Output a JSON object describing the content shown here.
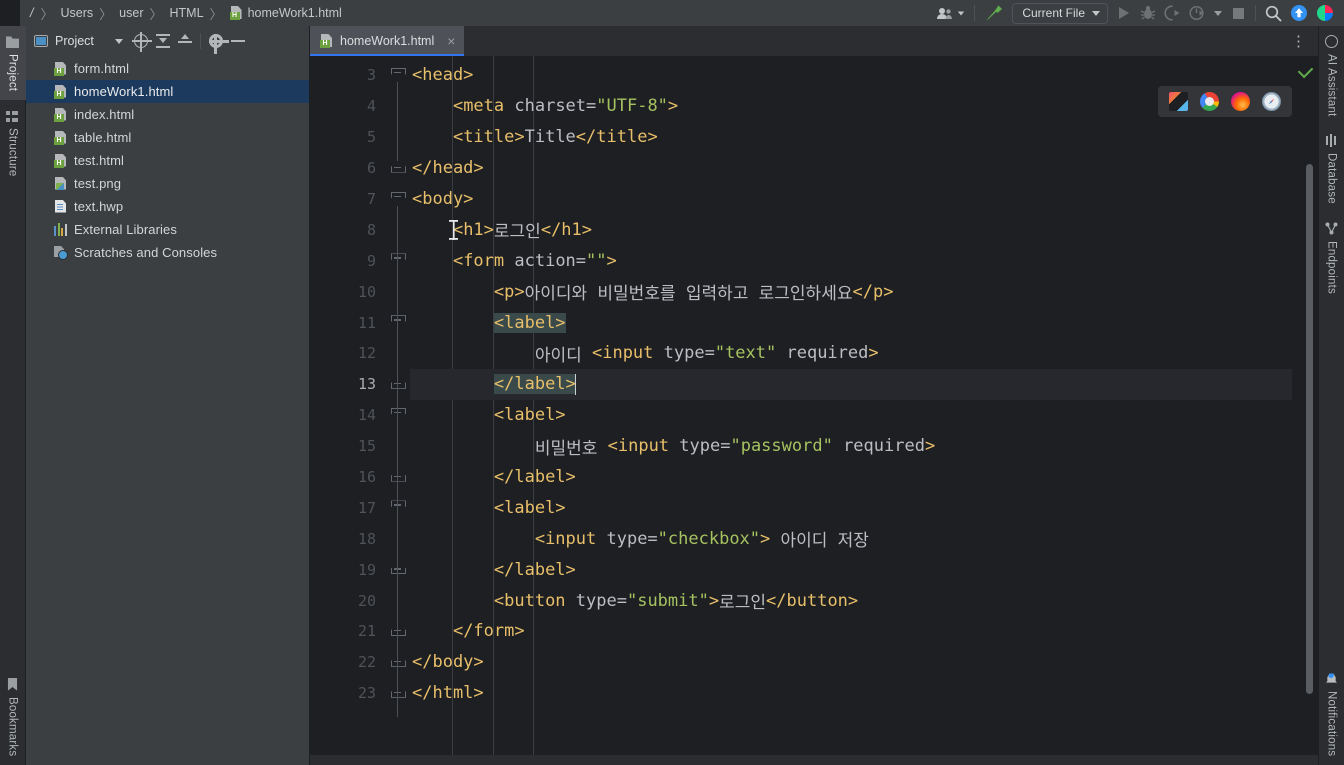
{
  "breadcrumb": {
    "root": "/",
    "items": [
      "Users",
      "user",
      "HTML"
    ],
    "file": "homeWork1.html",
    "separator": "〉"
  },
  "topbar_right": {
    "account_icon": "user-group-icon",
    "build_icon": "hammer-icon",
    "run_config": "Current File",
    "run_icon": "run-play-icon",
    "debug_icon": "debug-bug-icon",
    "run_coverage_icon": "run-with-coverage-icon",
    "profiler_icon": "profiler-icon",
    "stop_icon": "stop-icon",
    "search_icon": "search-icon",
    "update_icon": "update-project-icon",
    "ide_icon": "intellij-logo-icon"
  },
  "left_strip": {
    "tabs": [
      {
        "label": "Project",
        "icon": "folder-icon",
        "active": true
      },
      {
        "label": "Structure",
        "icon": "structure-icon",
        "active": false
      }
    ],
    "bottom": {
      "label": "Bookmarks",
      "icon": "bookmark-icon"
    }
  },
  "right_strip": {
    "tabs": [
      {
        "label": "AI Assistant",
        "icon": "ai-assistant-icon"
      },
      {
        "label": "Database",
        "icon": "database-icon"
      },
      {
        "label": "Endpoints",
        "icon": "endpoints-icon"
      }
    ],
    "bottom": {
      "label": "Notifications",
      "icon": "bell-icon"
    }
  },
  "project_panel": {
    "title": "Project",
    "toolbar": [
      {
        "name": "view-mode-dropdown",
        "icon": "chevron-down-icon"
      },
      {
        "name": "select-opened-file",
        "icon": "target-icon"
      },
      {
        "name": "expand-all",
        "icon": "expand-all-icon"
      },
      {
        "name": "collapse-all",
        "icon": "collapse-all-icon"
      },
      {
        "name": "panel-settings",
        "icon": "gear-icon"
      },
      {
        "name": "hide-panel",
        "icon": "minus-icon"
      }
    ],
    "tree": [
      {
        "label": "form.html",
        "icon": "html-file-icon",
        "selected": false
      },
      {
        "label": "homeWork1.html",
        "icon": "html-file-icon",
        "selected": true
      },
      {
        "label": "index.html",
        "icon": "html-file-icon",
        "selected": false
      },
      {
        "label": "table.html",
        "icon": "html-file-icon",
        "selected": false
      },
      {
        "label": "test.html",
        "icon": "html-file-icon",
        "selected": false
      },
      {
        "label": "test.png",
        "icon": "png-file-icon",
        "selected": false
      },
      {
        "label": "text.hwp",
        "icon": "hwp-file-icon",
        "selected": false
      },
      {
        "label": "External Libraries",
        "icon": "libraries-icon",
        "selected": false
      },
      {
        "label": "Scratches and Consoles",
        "icon": "scratches-icon",
        "selected": false
      }
    ]
  },
  "editor": {
    "tab": {
      "label": "homeWork1.html",
      "icon": "html-file-icon",
      "close": "×"
    },
    "options_icon": "more-options-kebab-icon",
    "preview_browsers": [
      {
        "name": "builtin-preview-icon",
        "title": "IntelliJ Preview"
      },
      {
        "name": "chrome-icon",
        "title": "Chrome"
      },
      {
        "name": "firefox-icon",
        "title": "Firefox"
      },
      {
        "name": "safari-icon",
        "title": "Safari"
      }
    ],
    "inspection_status": "no-problems-check-icon",
    "first_visible_line": 3,
    "caret_line": 13,
    "lines": [
      {
        "num": 3,
        "indent": 0,
        "fold": "open",
        "current": false,
        "parts": [
          {
            "t": "<head>",
            "c": "s-tag"
          }
        ]
      },
      {
        "num": 4,
        "indent": 1,
        "fold": "",
        "current": false,
        "parts": [
          {
            "t": "<meta",
            "c": "s-tag"
          },
          {
            "t": " charset=",
            "c": "s-attr"
          },
          {
            "t": "\"UTF-8\"",
            "c": "s-str"
          },
          {
            "t": ">",
            "c": "s-tag"
          }
        ]
      },
      {
        "num": 5,
        "indent": 1,
        "fold": "",
        "current": false,
        "parts": [
          {
            "t": "<title>",
            "c": "s-tag"
          },
          {
            "t": "Title",
            "c": "s-txt"
          },
          {
            "t": "</title>",
            "c": "s-tag"
          }
        ]
      },
      {
        "num": 6,
        "indent": 0,
        "fold": "close",
        "current": false,
        "parts": [
          {
            "t": "</head>",
            "c": "s-tag"
          }
        ]
      },
      {
        "num": 7,
        "indent": 0,
        "fold": "open",
        "current": false,
        "parts": [
          {
            "t": "<body>",
            "c": "s-tag"
          }
        ]
      },
      {
        "num": 8,
        "indent": 1,
        "fold": "",
        "current": false,
        "parts": [
          {
            "t": "<h1>",
            "c": "s-tag"
          },
          {
            "t": "로그인",
            "c": "s-txt"
          },
          {
            "t": "</h1>",
            "c": "s-tag"
          }
        ]
      },
      {
        "num": 9,
        "indent": 1,
        "fold": "open",
        "current": false,
        "parts": [
          {
            "t": "<form",
            "c": "s-tag"
          },
          {
            "t": " action=",
            "c": "s-attr"
          },
          {
            "t": "\"\"",
            "c": "s-str"
          },
          {
            "t": ">",
            "c": "s-tag"
          }
        ]
      },
      {
        "num": 10,
        "indent": 2,
        "fold": "",
        "current": false,
        "parts": [
          {
            "t": "<p>",
            "c": "s-tag"
          },
          {
            "t": "아이디와 비밀번호를 입력하고 로그인하세요",
            "c": "s-txt"
          },
          {
            "t": "</p>",
            "c": "s-tag"
          }
        ]
      },
      {
        "num": 11,
        "indent": 2,
        "fold": "open",
        "current": false,
        "parts": [
          {
            "t": "<label>",
            "c": "s-tag hl-pair"
          }
        ]
      },
      {
        "num": 12,
        "indent": 3,
        "fold": "",
        "current": false,
        "parts": [
          {
            "t": "아이디 ",
            "c": "s-txt"
          },
          {
            "t": "<input",
            "c": "s-tag"
          },
          {
            "t": " type=",
            "c": "s-attr"
          },
          {
            "t": "\"text\"",
            "c": "s-str"
          },
          {
            "t": " required",
            "c": "s-attr"
          },
          {
            "t": ">",
            "c": "s-tag"
          }
        ]
      },
      {
        "num": 13,
        "indent": 2,
        "fold": "close",
        "current": true,
        "parts": [
          {
            "t": "</label>",
            "c": "s-tag hl-pair"
          },
          {
            "t": "",
            "c": "caret"
          }
        ]
      },
      {
        "num": 14,
        "indent": 2,
        "fold": "open",
        "current": false,
        "parts": [
          {
            "t": "<label>",
            "c": "s-tag"
          }
        ]
      },
      {
        "num": 15,
        "indent": 3,
        "fold": "",
        "current": false,
        "parts": [
          {
            "t": "비밀번호 ",
            "c": "s-txt"
          },
          {
            "t": "<input",
            "c": "s-tag"
          },
          {
            "t": " type=",
            "c": "s-attr"
          },
          {
            "t": "\"password\"",
            "c": "s-str"
          },
          {
            "t": " required",
            "c": "s-attr"
          },
          {
            "t": ">",
            "c": "s-tag"
          }
        ]
      },
      {
        "num": 16,
        "indent": 2,
        "fold": "close",
        "current": false,
        "parts": [
          {
            "t": "</label>",
            "c": "s-tag"
          }
        ]
      },
      {
        "num": 17,
        "indent": 2,
        "fold": "open",
        "current": false,
        "parts": [
          {
            "t": "<label>",
            "c": "s-tag"
          }
        ]
      },
      {
        "num": 18,
        "indent": 3,
        "fold": "",
        "current": false,
        "parts": [
          {
            "t": "<input",
            "c": "s-tag"
          },
          {
            "t": " type=",
            "c": "s-attr"
          },
          {
            "t": "\"checkbox\"",
            "c": "s-str"
          },
          {
            "t": ">",
            "c": "s-tag"
          },
          {
            "t": " 아이디 저장",
            "c": "s-txt"
          }
        ]
      },
      {
        "num": 19,
        "indent": 2,
        "fold": "close",
        "current": false,
        "parts": [
          {
            "t": "</label>",
            "c": "s-tag"
          }
        ]
      },
      {
        "num": 20,
        "indent": 2,
        "fold": "",
        "current": false,
        "parts": [
          {
            "t": "<button",
            "c": "s-tag"
          },
          {
            "t": " type=",
            "c": "s-attr"
          },
          {
            "t": "\"submit\"",
            "c": "s-str"
          },
          {
            "t": ">",
            "c": "s-tag"
          },
          {
            "t": "로그인",
            "c": "s-txt"
          },
          {
            "t": "</button>",
            "c": "s-tag"
          }
        ]
      },
      {
        "num": 21,
        "indent": 1,
        "fold": "close",
        "current": false,
        "parts": [
          {
            "t": "</form>",
            "c": "s-tag"
          }
        ]
      },
      {
        "num": 22,
        "indent": 0,
        "fold": "close",
        "current": false,
        "parts": [
          {
            "t": "</body>",
            "c": "s-tag"
          }
        ]
      },
      {
        "num": 23,
        "indent": 0,
        "fold": "close",
        "current": false,
        "parts": [
          {
            "t": "</html>",
            "c": "s-tag"
          }
        ]
      }
    ]
  },
  "colors": {
    "editor_bg": "#1e1f22",
    "panel_bg": "#3c3f41",
    "chrome_bg": "#2b2d30",
    "accent_blue": "#3574f0",
    "selection_blue": "#1c3a5e",
    "tag": "#e8bf6a",
    "string": "#a5c261",
    "text": "#bcbec4",
    "ok_green": "#5fad4e"
  }
}
